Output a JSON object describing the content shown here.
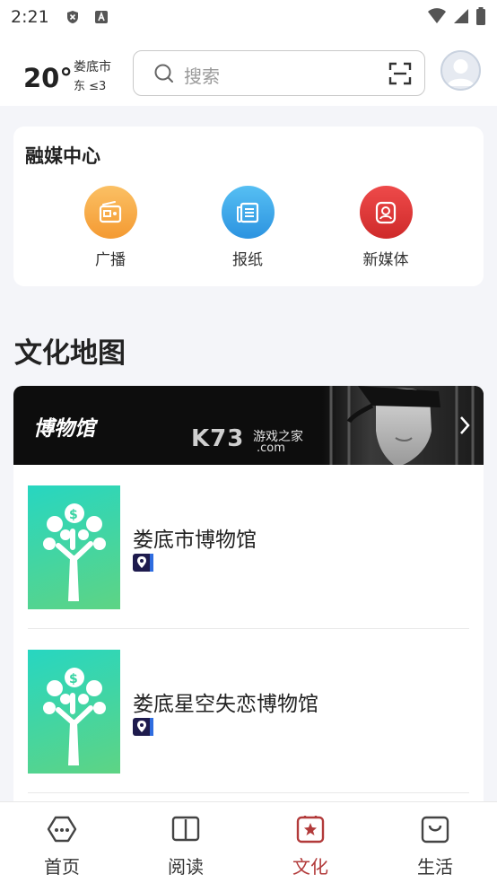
{
  "status_bar": {
    "time": "2:21"
  },
  "header": {
    "temperature": "20°",
    "city": "娄底市",
    "wind": "东 ≤3",
    "search_placeholder": "搜索"
  },
  "media_center": {
    "title": "融媒中心",
    "items": [
      {
        "label": "广播",
        "icon": "radio-icon",
        "color": "#f9a94a"
      },
      {
        "label": "报纸",
        "icon": "newspaper-icon",
        "color": "#3aa6ea"
      },
      {
        "label": "新媒体",
        "icon": "new-media-icon",
        "color": "#e03b3b"
      }
    ]
  },
  "culture_map": {
    "title": "文化地图",
    "banner": {
      "title": "博物馆",
      "watermark": "K73",
      "watermark_sub1": "游戏之家",
      "watermark_sub2": ".com"
    },
    "museums": [
      {
        "name": "娄底市博物馆"
      },
      {
        "name": "娄底星空失恋博物馆"
      }
    ]
  },
  "bottom_nav": {
    "items": [
      {
        "label": "首页",
        "icon": "home-icon",
        "active": false
      },
      {
        "label": "阅读",
        "icon": "book-icon",
        "active": false
      },
      {
        "label": "文化",
        "icon": "culture-star-icon",
        "active": true
      },
      {
        "label": "生活",
        "icon": "bag-icon",
        "active": false
      }
    ],
    "active_color": "#b23a3a"
  }
}
